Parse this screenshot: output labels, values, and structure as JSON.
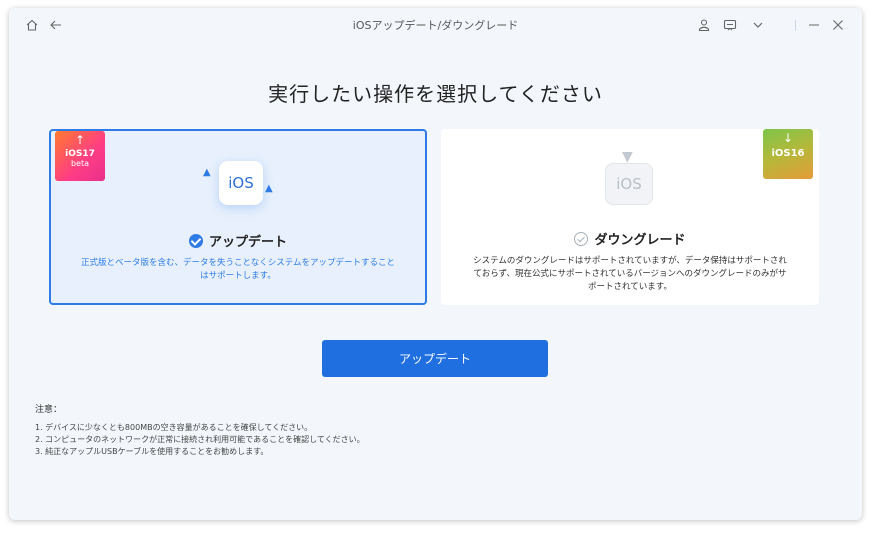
{
  "window": {
    "title": "iOSアップデート/ダウングレード"
  },
  "titlebar": {
    "icons": [
      "home-icon",
      "back-arrow-icon",
      "user-icon",
      "feedback-icon",
      "chevron-down-icon",
      "minimize-icon",
      "close-icon"
    ]
  },
  "main": {
    "heading": "実行したい操作を選択してください",
    "options": [
      {
        "title": "アップデート",
        "badge_label": "iOS17",
        "badge_sub": "beta",
        "tile_label": "iOS",
        "description": "正式版とベータ版を含む、データを失うことなくシステムをアップデートすることはサポートします。",
        "selected": true
      },
      {
        "title": "ダウングレード",
        "badge_label": "iOS16",
        "tile_label": "iOS",
        "description": "システムのダウングレードはサポートされていますが、データ保持はサポートされておらず、現在公式にサポートされているバージョンへのダウングレードのみがサポートされています。",
        "selected": false
      }
    ],
    "primary_button": "アップデート"
  },
  "notes": {
    "title": "注意：",
    "items": [
      "1. デバイスに少なくとも800MBの空き容量があることを確保してください。",
      "2. コンピュータのネットワークが正常に接続され利用可能であることを確認してください。",
      "3. 純正なアップルUSBケーブルを使用することをお勧めします。"
    ]
  },
  "colors": {
    "accent": "#2f7be6",
    "button": "#1f6fe0",
    "window_bg": "#f3f7fb"
  }
}
